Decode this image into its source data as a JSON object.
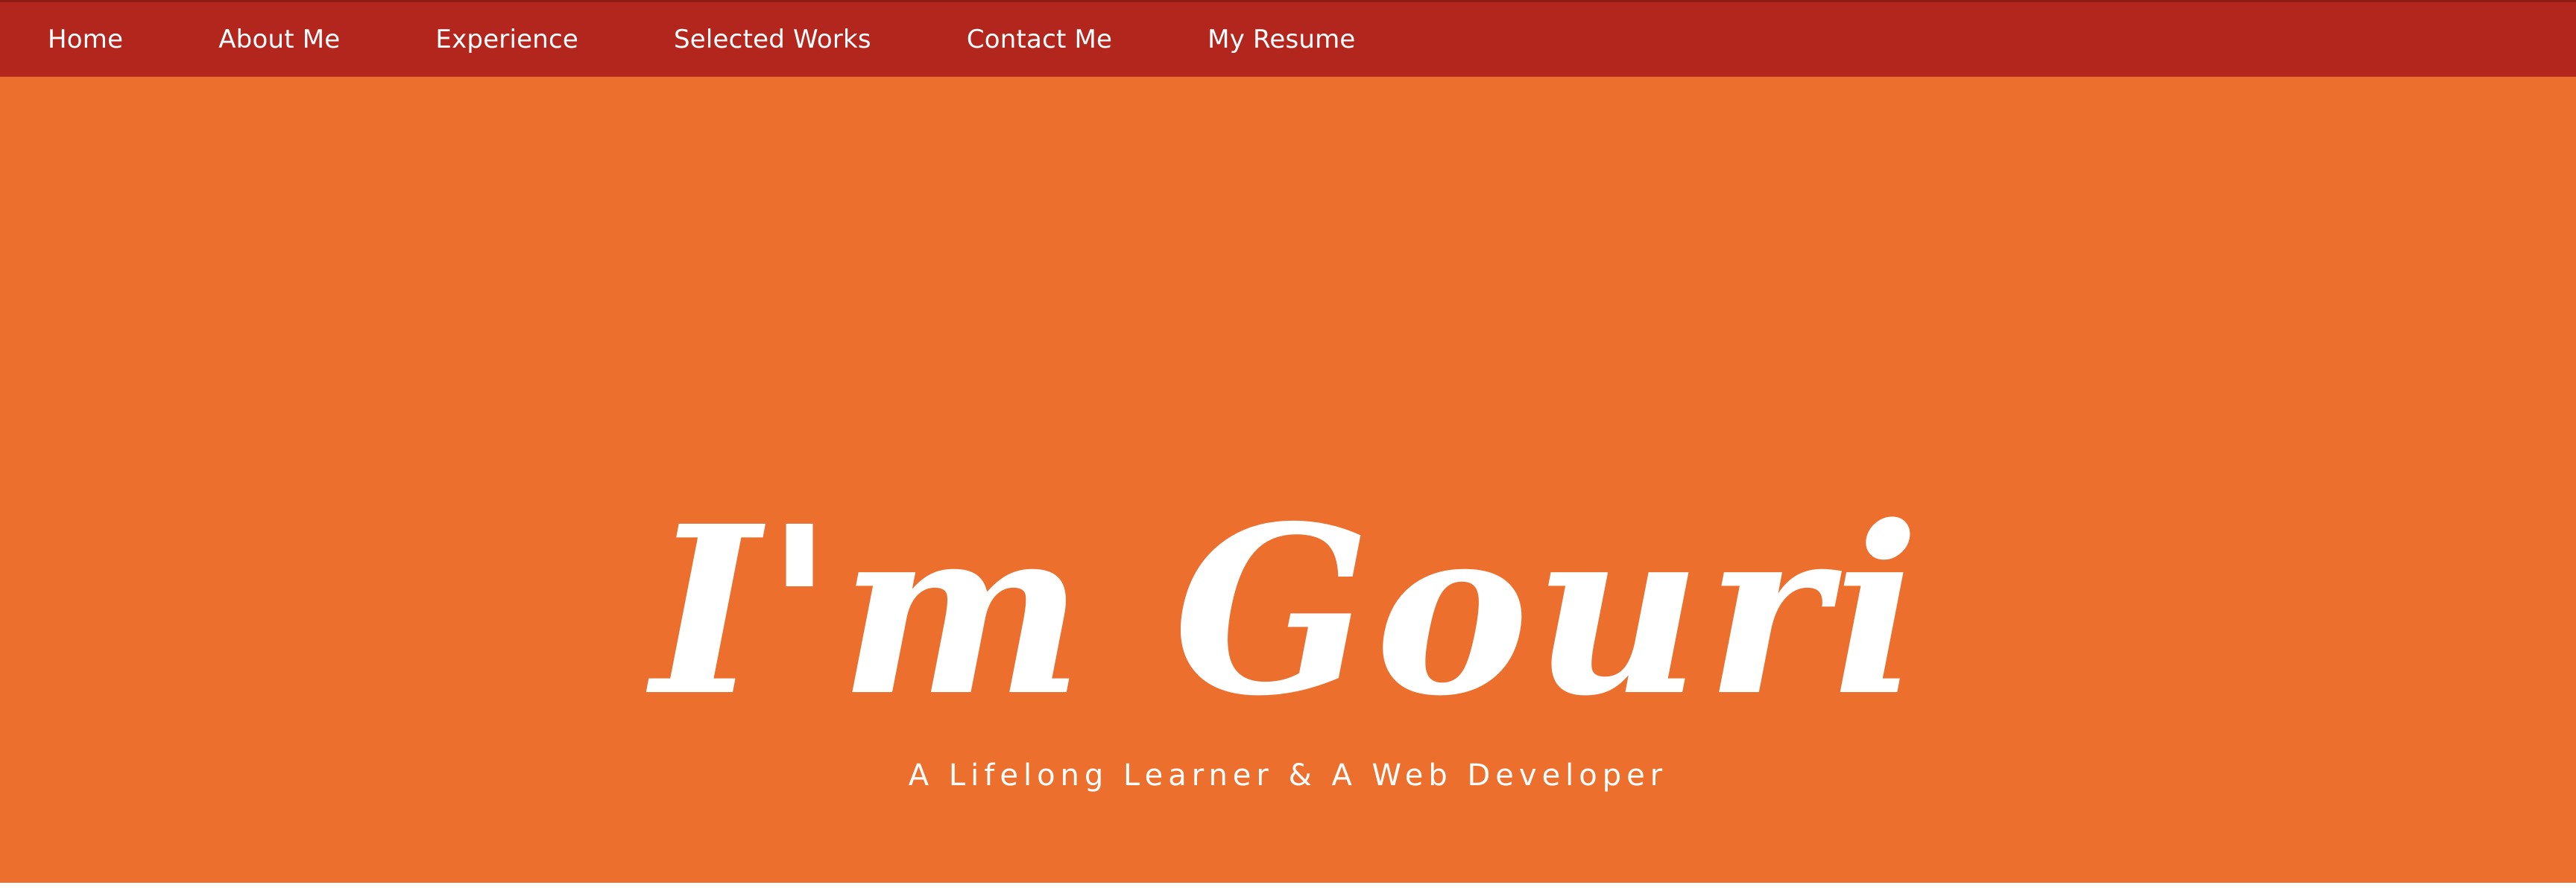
{
  "nav": {
    "items": [
      {
        "label": "Home"
      },
      {
        "label": "About Me"
      },
      {
        "label": "Experience"
      },
      {
        "label": "Selected Works"
      },
      {
        "label": "Contact Me"
      },
      {
        "label": "My Resume"
      }
    ]
  },
  "hero": {
    "title": "I'm Gouri",
    "subtitle": "A Lifelong Learner & A Web Developer"
  },
  "colors": {
    "nav_background": "#b3261e",
    "hero_background": "#ec6f2d",
    "text": "#ffffff"
  }
}
